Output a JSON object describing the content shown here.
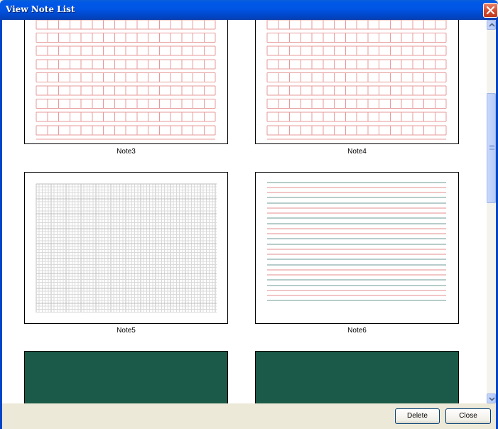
{
  "window": {
    "title": "View Note List"
  },
  "notes": [
    {
      "name": "Note3",
      "paper": "red-grid"
    },
    {
      "name": "Note4",
      "paper": "red-grid"
    },
    {
      "name": "Note5",
      "paper": "graph-paper"
    },
    {
      "name": "Note6",
      "paper": "staff-lines"
    },
    {
      "name": "",
      "paper": "chalkboard"
    },
    {
      "name": "",
      "paper": "chalkboard"
    }
  ],
  "buttons": {
    "delete": "Delete",
    "close": "Close"
  },
  "colors": {
    "titlebar": "#0055e5",
    "grid_red": "#e79a9a",
    "staff_red": "#e58c8c",
    "staff_teal": "#6c9b95",
    "chalkboard": "#1b5a48",
    "dialog_face": "#ece9d8"
  },
  "icons": {
    "close": "close-icon",
    "scroll_up": "chevron-up-icon",
    "scroll_down": "chevron-down-icon"
  }
}
